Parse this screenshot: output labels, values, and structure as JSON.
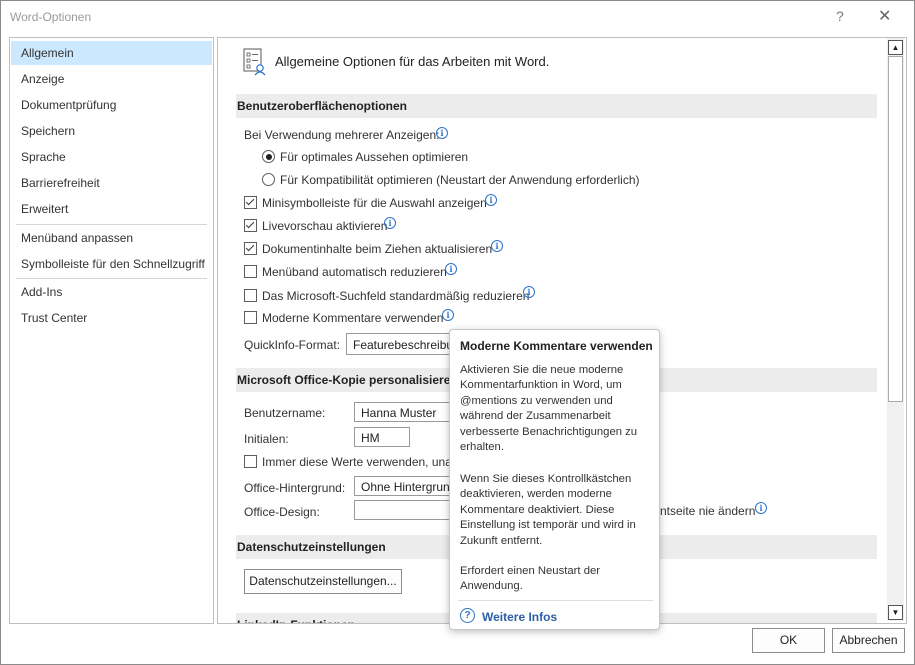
{
  "window": {
    "title": "Word-Optionen",
    "help_glyph": "?",
    "close_glyph": "✕"
  },
  "nav": {
    "items": [
      "Allgemein",
      "Anzeige",
      "Dokumentprüfung",
      "Speichern",
      "Sprache",
      "Barrierefreiheit",
      "Erweitert",
      "Menüband anpassen",
      "Symbolleiste für den Schnellzugriff",
      "Add-Ins",
      "Trust Center"
    ],
    "selected": "Allgemein"
  },
  "main": {
    "header": "Allgemeine Optionen für das Arbeiten mit Word.",
    "sections": {
      "ui": "Benutzeroberflächenoptionen",
      "personalize": "Microsoft Office-Kopie personalisieren",
      "privacy": "Datenschutzeinstellungen",
      "linkedin": "LinkedIn-Funktionen"
    },
    "multi_display_label": "Bei Verwendung mehrerer Anzeigen:",
    "radio_optimal": "Für optimales Aussehen optimieren",
    "radio_compat": "Für Kompatibilität optimieren (Neustart der Anwendung erforderlich)",
    "checkboxes": [
      {
        "label": "Minisymbolleiste für die Auswahl anzeigen",
        "checked": true
      },
      {
        "label": "Livevorschau aktivieren",
        "checked": true
      },
      {
        "label": "Dokumentinhalte beim Ziehen aktualisieren",
        "checked": true
      },
      {
        "label": "Menüband automatisch reduzieren",
        "checked": false
      },
      {
        "label": "Das Microsoft-Suchfeld standardmäßig reduzieren",
        "checked": false
      },
      {
        "label": "Moderne Kommentare verwenden",
        "checked": false
      }
    ],
    "quickinfo_label": "QuickInfo-Format:",
    "quickinfo_value": "Featurebeschreibu",
    "username_label": "Benutzername:",
    "username_value": "Hanna Muster",
    "initials_label": "Initialen:",
    "initials_value": "HM",
    "always_values_label": "Immer diese Werte verwenden, unab",
    "background_label": "Office-Hintergrund:",
    "background_value": "Ohne Hintergrun",
    "design_label": "Office-Design:",
    "design_value": "",
    "design_tail": "ntseite nie ändern",
    "privacy_button": "Datenschutzeinstellungen..."
  },
  "tooltip": {
    "title": "Moderne Kommentare verwenden",
    "para1": "Aktivieren Sie die neue moderne Kommentarfunktion in Word, um @mentions zu verwenden und während der Zusammenarbeit verbesserte Benachrichtigungen zu erhalten.",
    "para2": "Wenn Sie dieses Kontrollkästchen deaktivieren, werden moderne Kommentare deaktiviert. Diese Einstellung ist temporär und wird in Zukunft entfernt.",
    "para3": "Erfordert einen Neustart der Anwendung.",
    "link": "Weitere Infos"
  },
  "footer": {
    "ok": "OK",
    "cancel": "Abbrechen"
  },
  "colors": {
    "selection": "#cce8ff",
    "section_bg": "#ececec",
    "info_blue": "#2b73c8"
  }
}
